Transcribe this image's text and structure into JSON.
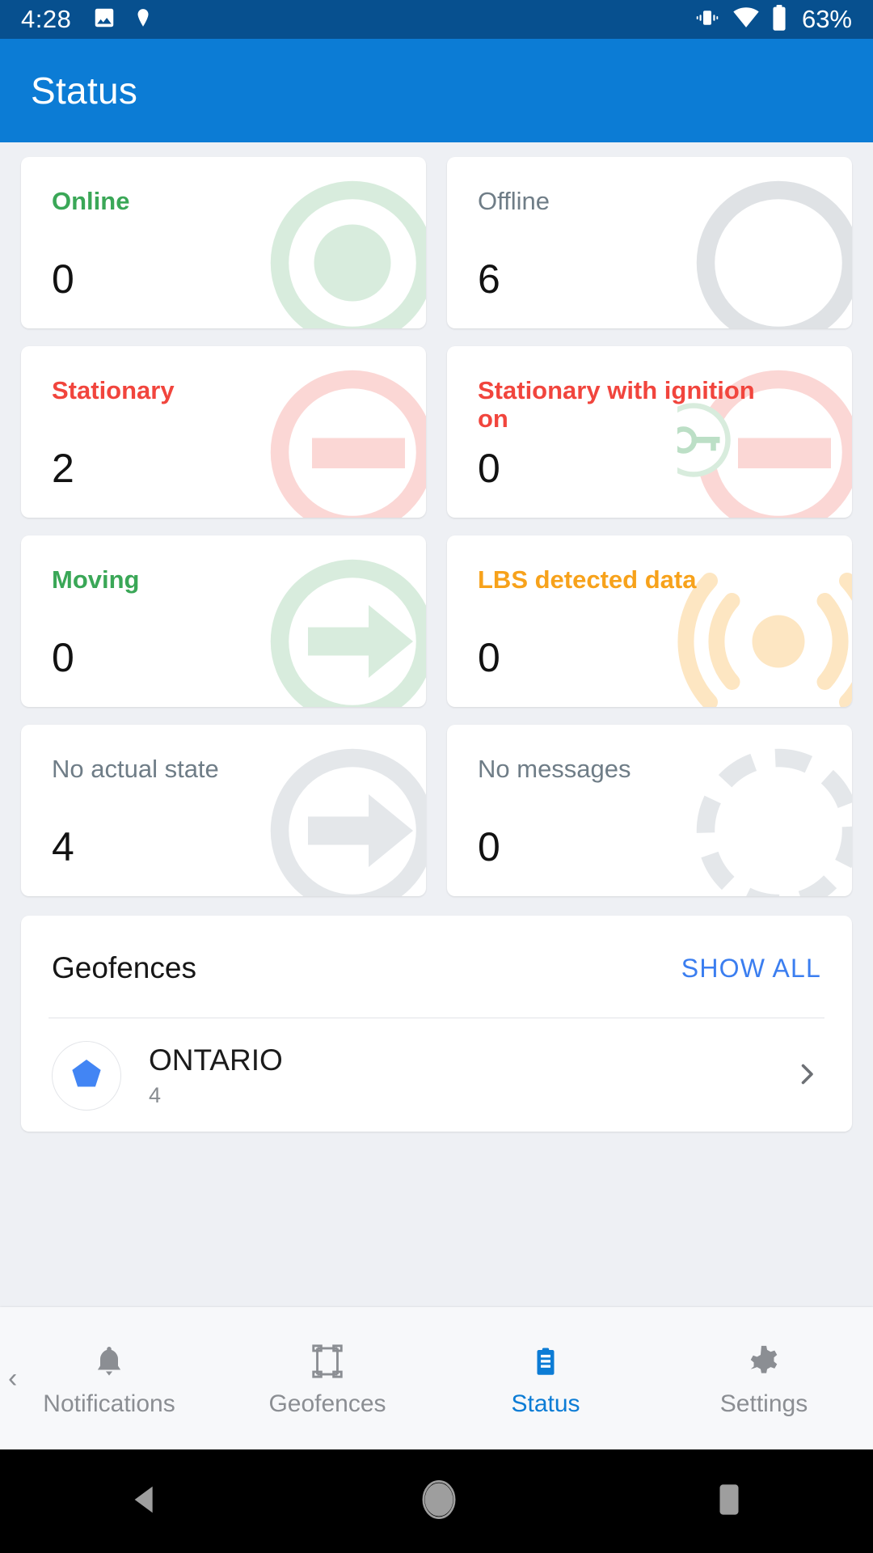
{
  "status_bar": {
    "time": "4:28",
    "battery_text": "63%",
    "icons": [
      "image-icon",
      "location-pin-icon",
      "vibrate-icon",
      "wifi-icon",
      "battery-icon"
    ],
    "background_color": "#07508f"
  },
  "app_bar": {
    "title": "Status",
    "background_color": "#0c7cd5"
  },
  "status_cards": [
    {
      "title": "Online",
      "value": "0",
      "color": "#3aa757",
      "icon": "online-circle-icon",
      "art_color": "#d8ecdd"
    },
    {
      "title": "Offline",
      "value": "6",
      "color": "#6f7d87",
      "icon": "offline-circle-icon",
      "art_color": "#dfe2e5"
    },
    {
      "title": "Stationary",
      "value": "2",
      "color": "#f1453d",
      "icon": "stationary-icon",
      "art_color": "#fbd7d5"
    },
    {
      "title": "Stationary with ignition on",
      "value": "0",
      "color": "#f1453d",
      "icon": "ignition-key-icon",
      "art_color": "#fbd7d5"
    },
    {
      "title": "Moving",
      "value": "0",
      "color": "#3aa757",
      "icon": "moving-arrow-icon",
      "art_color": "#d8ecdd"
    },
    {
      "title": "LBS detected data",
      "value": "0",
      "color": "#f7a21b",
      "icon": "lbs-signal-icon",
      "art_color": "#fde6c2"
    },
    {
      "title": "No actual state",
      "value": "4",
      "color": "#6f7d87",
      "icon": "no-state-arrow-icon",
      "art_color": "#e4e7ea"
    },
    {
      "title": "No messages",
      "value": "0",
      "color": "#6f7d87",
      "icon": "no-messages-dashed-icon",
      "art_color": "#e4e7ea"
    }
  ],
  "geofences": {
    "heading": "Geofences",
    "show_all_label": "SHOW ALL",
    "accent_color": "#3b7ef0",
    "items": [
      {
        "name": "ONTARIO",
        "count": "4",
        "icon": "pentagon-geofence-icon",
        "icon_color": "#4285f4"
      }
    ]
  },
  "bottom_nav": {
    "active_color": "#0c7cd5",
    "inactive_color": "#8b8e93",
    "items": [
      {
        "label": "Notifications",
        "icon": "bell-icon",
        "active": false
      },
      {
        "label": "Geofences",
        "icon": "frame-icon",
        "active": false
      },
      {
        "label": "Status",
        "icon": "clipboard-icon",
        "active": true
      },
      {
        "label": "Settings",
        "icon": "gear-icon",
        "active": false
      }
    ]
  },
  "android_nav": {
    "buttons": [
      "back-triangle-icon",
      "home-circle-icon",
      "recents-square-icon"
    ]
  }
}
